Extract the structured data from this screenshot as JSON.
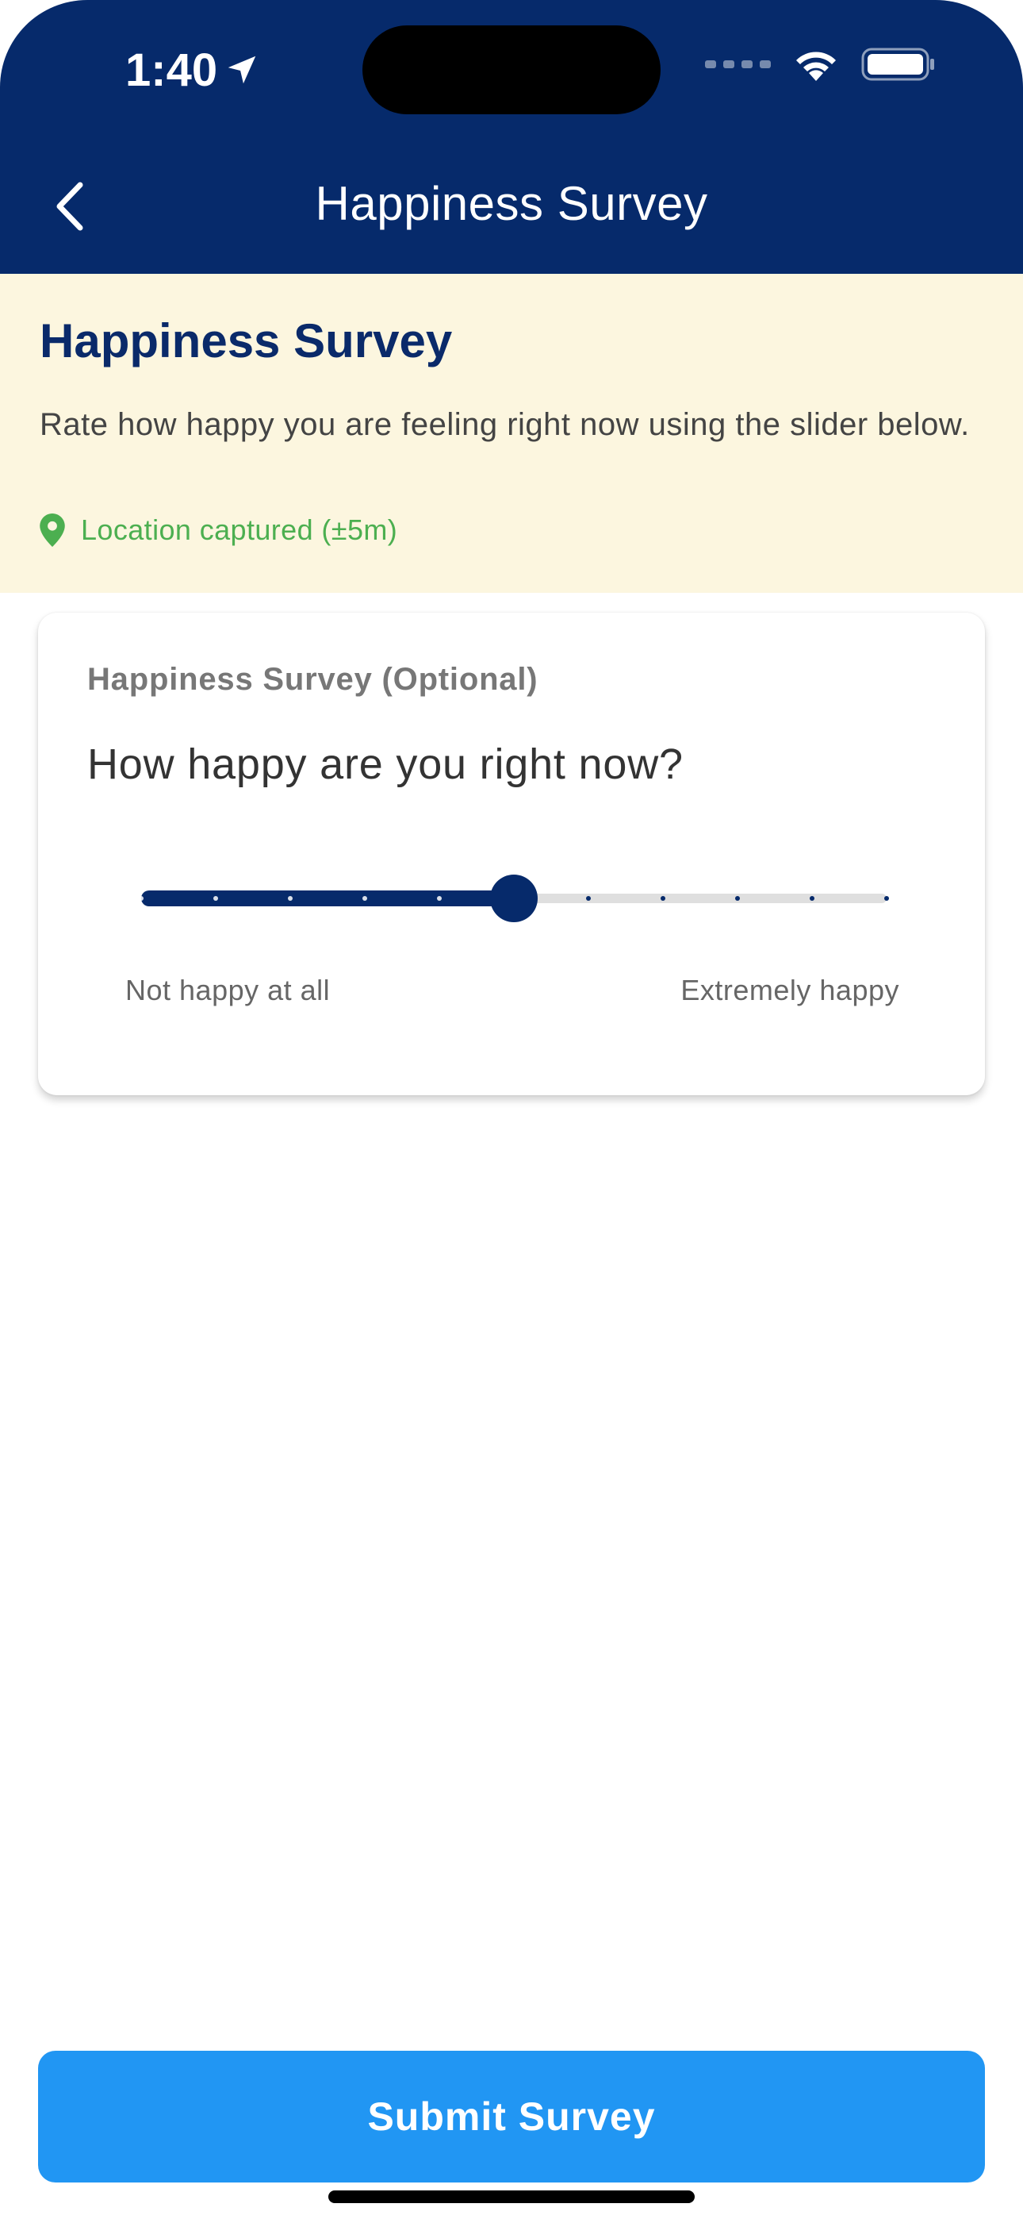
{
  "status_bar": {
    "time": "1:40"
  },
  "nav": {
    "title": "Happiness Survey"
  },
  "intro": {
    "title": "Happiness Survey",
    "description": "Rate how happy you are feeling right now using the slider below.",
    "location": "Location captured (±5m)"
  },
  "card": {
    "label": "Happiness Survey (Optional)",
    "question": "How happy are you right now?",
    "slider": {
      "min_label": "Not happy at all",
      "max_label": "Extremely happy",
      "min": 0,
      "max": 10,
      "value": 5,
      "steps": 10
    }
  },
  "submit": {
    "label": "Submit Survey"
  },
  "colors": {
    "primary": "#062a6b",
    "accent": "#2196f3",
    "banner": "#fcf6df",
    "location": "#4caf50"
  }
}
